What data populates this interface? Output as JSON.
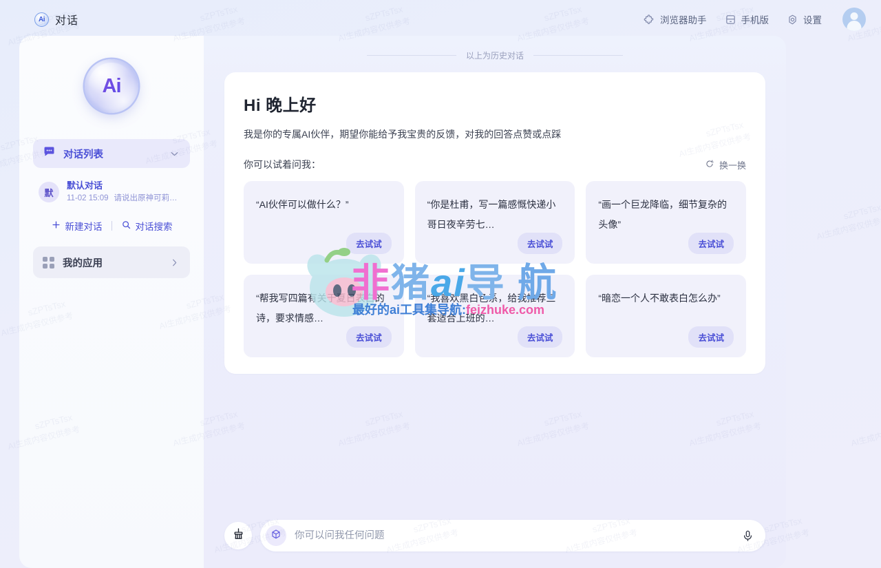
{
  "header": {
    "brand_mark": "Ai",
    "brand_title": "对话",
    "items": [
      {
        "label": "浏览器助手",
        "icon": "puzzle-icon"
      },
      {
        "label": "手机版",
        "icon": "mobile-icon"
      },
      {
        "label": "设置",
        "icon": "gear-icon"
      }
    ],
    "avatar_alt": "用户头像"
  },
  "sidebar": {
    "logo_text": "Ai",
    "conversation_list": {
      "label": "对话列表",
      "icon": "chat-bubble-icon",
      "expanded": true
    },
    "conversations": [
      {
        "avatar": "默",
        "title": "默认对话",
        "time": "11-02 15:09",
        "preview": "请说出原神可莉人…"
      }
    ],
    "actions": [
      {
        "label": "新建对话",
        "icon": "plus-icon"
      },
      {
        "label": "对话搜索",
        "icon": "search-icon"
      }
    ],
    "my_apps": {
      "label": "我的应用",
      "icon": "grid-icon"
    }
  },
  "main": {
    "history_divider": "以上为历史对话",
    "greeting_title": "Hi 晚上好",
    "greeting_subtitle": "我是你的专属AI伙伴，期望你能给予我宝贵的反馈，对我的回答点赞或点踩",
    "try_label": "你可以试着问我：",
    "refresh_label": "换一换",
    "suggestion_button_label": "去试试",
    "suggestions": [
      {
        "text": "“AI伙伴可以做什么？”"
      },
      {
        "text": "“你是杜甫，写一篇感慨快递小哥日夜辛劳七…"
      },
      {
        "text": "“画一个巨龙降临，细节复杂的头像”"
      },
      {
        "text": "“帮我写四篇有关于夏日表白的诗，要求情感…"
      },
      {
        "text": "“我喜欢黑白色系，给我推荐三套适合上班的…"
      },
      {
        "text": "“暗恋一个人不敢表白怎么办”"
      }
    ]
  },
  "composer": {
    "clear_icon": "broom-icon",
    "model_icon": "cube-icon",
    "placeholder": "你可以问我任何问题",
    "value": "",
    "mic_icon": "microphone-icon"
  },
  "watermarks": {
    "tag": "sZPTsTsx",
    "note": "AI生成内容仅供参考",
    "overlay_main": "非猪ai导航",
    "overlay_sub": "最好的ai工具集导航:feizhuke.com"
  },
  "colors": {
    "accent": "#4a4fd6",
    "page_bg": "#eceefb",
    "card_bg": "#f1f1fb",
    "panel_bg": "#ffffff"
  }
}
